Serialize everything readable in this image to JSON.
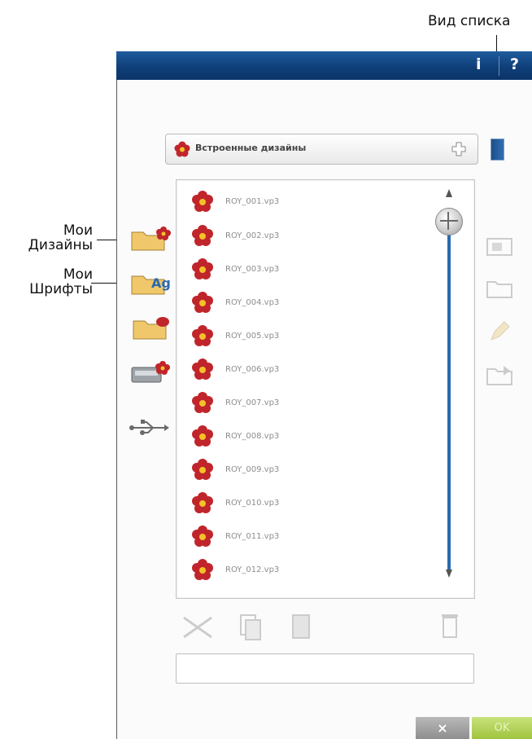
{
  "callouts": {
    "list_view": "Вид списка",
    "my_designs_1": "Мои",
    "my_designs_2": "Дизайны",
    "my_fonts_1": "Мои",
    "my_fonts_2": "Шрифты"
  },
  "topbar": {
    "info_label": "i",
    "help_label": "?"
  },
  "selector": {
    "label": "Встроенные дизайны"
  },
  "files": [
    "ROY_001.vp3",
    "ROY_002.vp3",
    "ROY_003.vp3",
    "ROY_004.vp3",
    "ROY_005.vp3",
    "ROY_006.vp3",
    "ROY_007.vp3",
    "ROY_008.vp3",
    "ROY_009.vp3",
    "ROY_010.vp3",
    "ROY_011.vp3",
    "ROY_012.vp3"
  ],
  "buttons": {
    "cancel_label": "×",
    "ok_label": "OK"
  },
  "colors": {
    "accent_blue": "#0e3d76",
    "ok_green": "#9fc43e",
    "flower_red": "#c0252b"
  }
}
